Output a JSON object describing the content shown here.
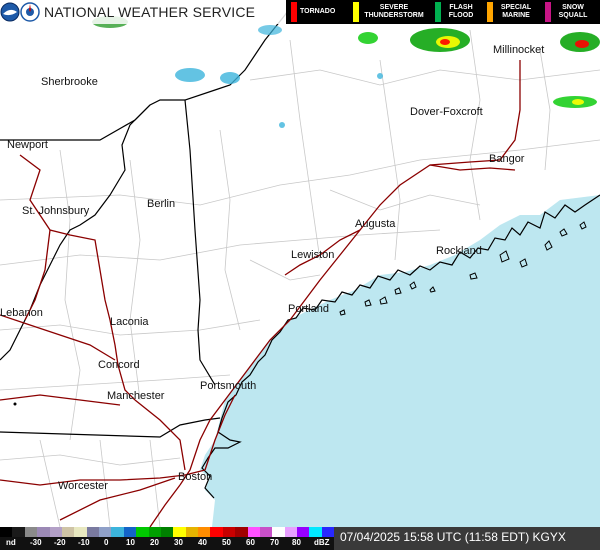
{
  "header": {
    "title": "NATIONAL WEATHER SERVICE"
  },
  "legend": [
    {
      "label": "TORNADO",
      "color": "#ff0000"
    },
    {
      "label": "SEVERE THUNDERSTORM",
      "color": "#ffff00"
    },
    {
      "label": "FLASH FLOOD",
      "color": "#00b050"
    },
    {
      "label": "SPECIAL MARINE",
      "color": "#ffa500"
    },
    {
      "label": "SNOW SQUALL",
      "color": "#c71585"
    }
  ],
  "cities": [
    {
      "name": "Sherbrooke"
    },
    {
      "name": "Millinocket"
    },
    {
      "name": "Dover-Foxcroft"
    },
    {
      "name": "Bangor"
    },
    {
      "name": "Newport"
    },
    {
      "name": "Berlin"
    },
    {
      "name": "St. Johnsbury"
    },
    {
      "name": "Augusta"
    },
    {
      "name": "Rockland"
    },
    {
      "name": "Lewiston"
    },
    {
      "name": "Portland"
    },
    {
      "name": "Lebanon"
    },
    {
      "name": "Laconia"
    },
    {
      "name": "Concord"
    },
    {
      "name": "Portsmouth"
    },
    {
      "name": "Manchester"
    },
    {
      "name": "Worcester"
    },
    {
      "name": "Boston"
    }
  ],
  "scale": {
    "labels": [
      "nd",
      "-30",
      "-20",
      "-10",
      "0",
      "10",
      "20",
      "30",
      "40",
      "50",
      "60",
      "70",
      "80",
      "dBZ"
    ],
    "colors": [
      "#000000",
      "#1a1a1a",
      "#8a8a8a",
      "#9b89b5",
      "#b3a0c7",
      "#cfc4a6",
      "#e8e8c0",
      "#7a7aa0",
      "#8fa0c8",
      "#3cb4dc",
      "#1464c8",
      "#00c800",
      "#00a000",
      "#008000",
      "#ffff00",
      "#e6b400",
      "#ff8c00",
      "#ff0000",
      "#c80000",
      "#a00000",
      "#ff50ff",
      "#c850c8",
      "#ffffff",
      "#e8a0ff",
      "#9600ff",
      "#00e8ff",
      "#2828ff"
    ]
  },
  "timestamp": "07/04/2025 15:58 UTC (11:58 EDT) KGYX",
  "colors": {
    "ocean": "#bde7f0",
    "land": "#ffffff",
    "state_border": "#000000",
    "county_border": "#c8c8c8",
    "highway": "#8b0000"
  }
}
